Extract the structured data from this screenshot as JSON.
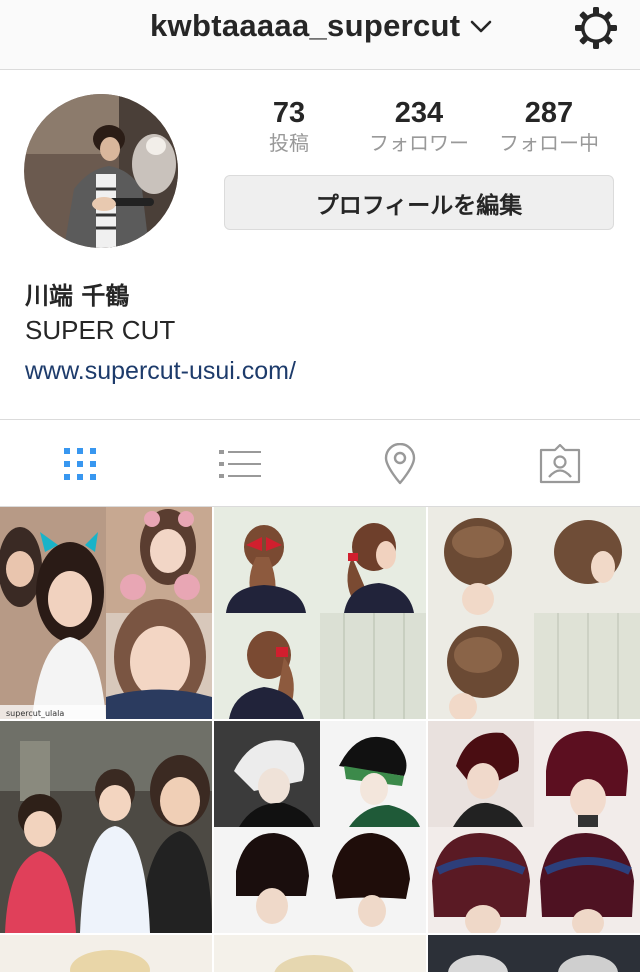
{
  "header": {
    "username": "kwbtaaaaa_supercut",
    "dropdown_icon": "chevron-down-icon",
    "settings_icon": "gear-icon"
  },
  "profile": {
    "stats": [
      {
        "value": "73",
        "label": "投稿"
      },
      {
        "value": "234",
        "label": "フォロワー"
      },
      {
        "value": "287",
        "label": "フォロー中"
      }
    ],
    "edit_button_label": "プロフィールを編集",
    "name": "川端 千鶴",
    "bio": "SUPER CUT",
    "website": "www.supercut-usui.com/"
  },
  "tabs": [
    {
      "name": "grid-view",
      "icon": "grid-icon",
      "active": true
    },
    {
      "name": "list-view",
      "icon": "list-icon",
      "active": false
    },
    {
      "name": "places",
      "icon": "location-pin-icon",
      "active": false
    },
    {
      "name": "tagged",
      "icon": "tagged-person-icon",
      "active": false
    }
  ],
  "posts": [
    {
      "description": "selfies with cat/mouse face filters",
      "watermark": "supercut_ulala"
    },
    {
      "description": "ponytail with red bow, four angles"
    },
    {
      "description": "braided updo, four angles"
    },
    {
      "description": "woman with two small children"
    },
    {
      "description": "platinum and black bob cuts on mannequins"
    },
    {
      "description": "burgundy bob haircuts"
    }
  ],
  "colors": {
    "accent_active_tab": "#3897f0",
    "link": "#1d3b6b",
    "button_bg": "#efefef",
    "muted_text": "#999999"
  }
}
